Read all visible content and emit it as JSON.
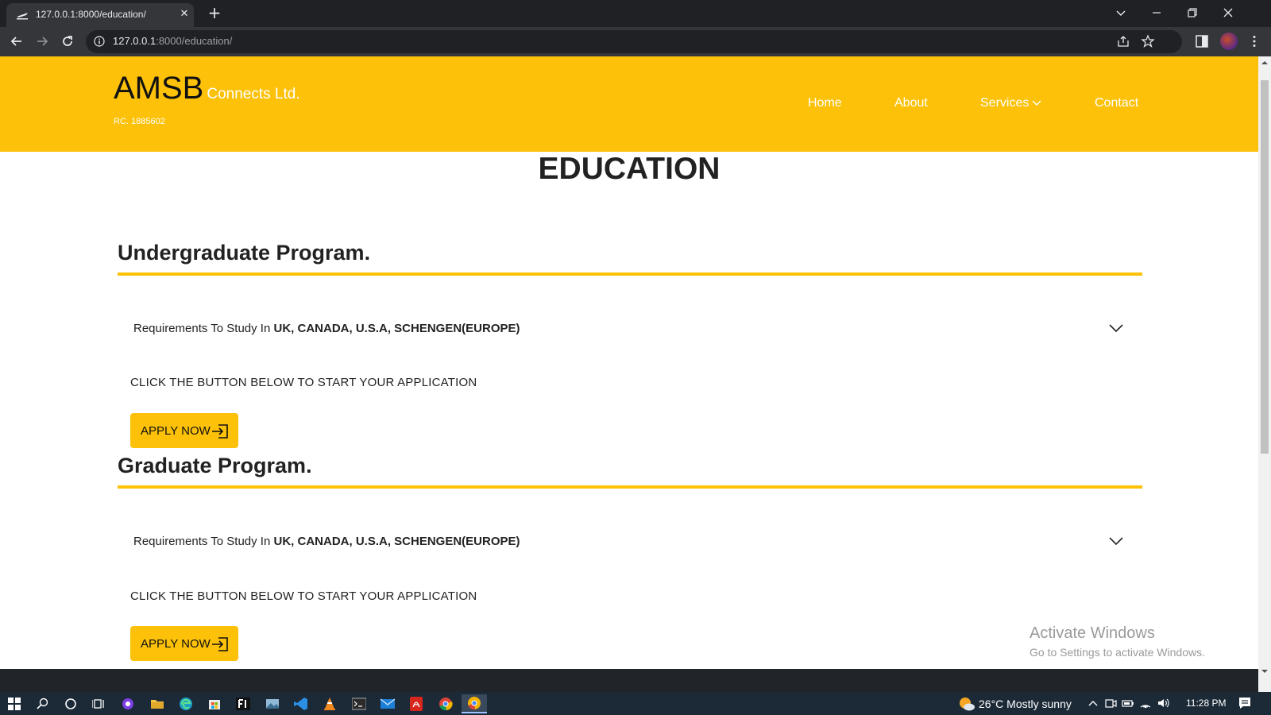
{
  "browser": {
    "tab_title": "127.0.0.1:8000/education/",
    "url_host": "127.0.0.1",
    "url_path": ":8000/education/"
  },
  "site": {
    "brand_main": "AMSB",
    "brand_sub": "Connects Ltd.",
    "brand_rc": "RC. 1885602",
    "nav": {
      "home": "Home",
      "about": "About",
      "services": "Services",
      "contact": "Contact"
    }
  },
  "page": {
    "title": "EDUCATION",
    "sections": [
      {
        "title": "Undergraduate Program.",
        "req_prefix": "Requirements To Study In ",
        "req_countries": "UK, CANADA, U.S.A, SCHENGEN(EUROPE)",
        "cta_text": "CLICK THE BUTTON BELOW TO START YOUR APPLICATION",
        "button_label": "APPLY NOW"
      },
      {
        "title": "Graduate Program.",
        "req_prefix": "Requirements To Study In ",
        "req_countries": "UK, CANADA, U.S.A, SCHENGEN(EUROPE)",
        "cta_text": "CLICK THE BUTTON BELOW TO START YOUR APPLICATION",
        "button_label": "APPLY NOW"
      }
    ]
  },
  "watermark": {
    "title": "Activate Windows",
    "subtitle": "Go to Settings to activate Windows."
  },
  "taskbar": {
    "weather": "26°C  Mostly sunny",
    "time": "11:28 PM"
  },
  "colors": {
    "brand_yellow": "#fcc108",
    "chrome_dark": "#202124",
    "taskbar": "#1c2a38"
  }
}
